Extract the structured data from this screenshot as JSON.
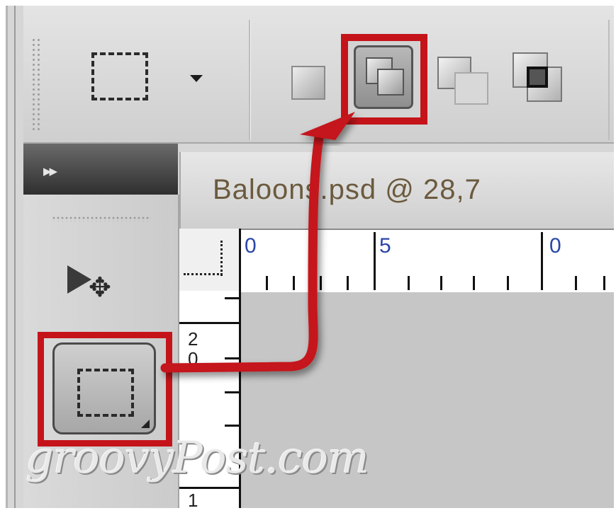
{
  "document": {
    "title": "Baloons.psd @ 28,7"
  },
  "ruler": {
    "h_labels": [
      {
        "text": "0",
        "color": "blue"
      },
      {
        "text": "5",
        "color": "blue"
      },
      {
        "text": "0",
        "color": "blue"
      }
    ],
    "v_labels": [
      "2",
      "0",
      "1"
    ]
  },
  "options_bar": {
    "preset_icon": "rectangular-marquee-icon",
    "modes": [
      "new-selection-icon",
      "add-to-selection-icon",
      "subtract-from-selection-icon",
      "intersect-with-selection-icon"
    ]
  },
  "toolbox": {
    "tools": [
      "move-tool-icon",
      "rectangular-marquee-icon"
    ]
  },
  "annotation": {
    "highlight_color": "#c4141a",
    "arrow": "from marquee tool to add-to-selection button"
  },
  "watermark": "groovyPost.com"
}
